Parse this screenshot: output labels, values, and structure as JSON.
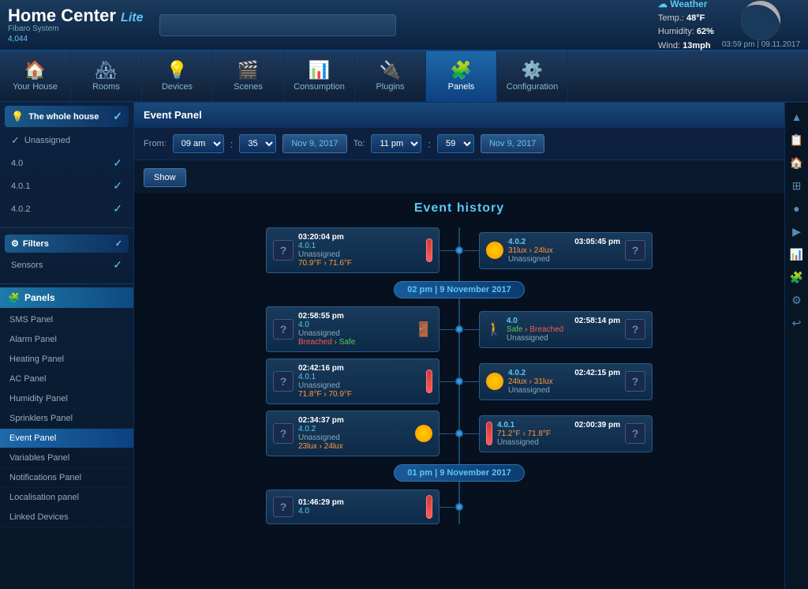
{
  "app": {
    "title": "Home Center",
    "subtitle": "Lite",
    "brand": "Fibaro System",
    "version": "4,044"
  },
  "weather": {
    "title": "Weather",
    "temp": "48°F",
    "humidity": "62%",
    "wind": "13mph",
    "datetime": "03:59 pm | 09.11.2017",
    "temp_label": "Temp.:",
    "humidity_label": "Humidity:",
    "wind_label": "Wind:"
  },
  "navbar": {
    "items": [
      {
        "id": "your-house",
        "label": "Your House",
        "icon": "🏠",
        "active": false
      },
      {
        "id": "rooms",
        "label": "Rooms",
        "icon": "🏘",
        "active": false
      },
      {
        "id": "devices",
        "label": "Devices",
        "icon": "💡",
        "active": false
      },
      {
        "id": "scenes",
        "label": "Scenes",
        "icon": "🎬",
        "active": false
      },
      {
        "id": "consumption",
        "label": "Consumption",
        "icon": "📊",
        "active": false
      },
      {
        "id": "plugins",
        "label": "Plugins",
        "icon": "🔌",
        "active": false
      },
      {
        "id": "panels",
        "label": "Panels",
        "icon": "🧩",
        "active": true
      },
      {
        "id": "configuration",
        "label": "Configuration",
        "icon": "⚙️",
        "active": false
      }
    ]
  },
  "sidebar": {
    "whole_house_label": "The whole house",
    "unassigned_label": "Unassigned",
    "items": [
      {
        "label": "4.0",
        "checked": true
      },
      {
        "label": "4.0.1",
        "checked": true
      },
      {
        "label": "4.0.2",
        "checked": true
      }
    ],
    "filters_label": "Filters",
    "sensors_label": "Sensors",
    "panels_label": "Panels",
    "panel_items": [
      {
        "label": "SMS Panel",
        "active": false
      },
      {
        "label": "Alarm Panel",
        "active": false
      },
      {
        "label": "Heating Panel",
        "active": false
      },
      {
        "label": "AC Panel",
        "active": false
      },
      {
        "label": "Humidity Panel",
        "active": false
      },
      {
        "label": "Sprinklers Panel",
        "active": false
      },
      {
        "label": "Event Panel",
        "active": true
      },
      {
        "label": "Variables Panel",
        "active": false
      },
      {
        "label": "Notifications Panel",
        "active": false
      },
      {
        "label": "Localisation panel",
        "active": false
      },
      {
        "label": "Linked Devices",
        "active": false
      }
    ]
  },
  "content": {
    "panel_title": "Event Panel",
    "filter": {
      "from_label": "From:",
      "to_label": "To:",
      "from_hour": "09 am",
      "from_min": "35",
      "from_date": "Nov 9, 2017",
      "to_hour": "11 pm",
      "to_min": "59",
      "to_date": "Nov 9, 2017",
      "show_label": "Show"
    },
    "event_history_title": "Event history",
    "date_markers": [
      {
        "label": "02 pm | 9 November 2017"
      },
      {
        "label": "01 pm | 9 November 2017"
      }
    ],
    "events_left": [
      {
        "time": "03:20:04 pm",
        "device": "Unassigned",
        "value": "70.9°F › 71.6°F",
        "icon_type": "therm"
      },
      {
        "time": "02:58:55 pm",
        "device": "Unassigned",
        "value": "Breached › Safe",
        "value_color": "safe",
        "icon_type": "door",
        "device_id": "4.0"
      },
      {
        "time": "02:42:16 pm",
        "device": "Unassigned",
        "value": "71.8°F › 70.9°F",
        "icon_type": "therm",
        "device_id": "4.0.1"
      },
      {
        "time": "02:34:37 pm",
        "device": "Unassigned",
        "value": "23lux › 24lux",
        "icon_type": "sun",
        "device_id": "4.0.2"
      }
    ],
    "events_right": [
      {
        "time": "03:05:45 pm",
        "device": "4.0.2",
        "value": "31lux › 24lux",
        "unassigned": "Unassigned",
        "icon_type": "sun"
      },
      {
        "time": "02:58:14 pm",
        "device": "4.0",
        "value": "Safe › Breached",
        "unassigned": "Unassigned",
        "icon_type": "walk"
      },
      {
        "time": "02:42:15 pm",
        "device": "4.0.2",
        "value": "24lux › 31lux",
        "unassigned": "Unassigned",
        "icon_type": "sun"
      },
      {
        "time": "02:00:39 pm",
        "device": "4.0.1",
        "value": "71.2°F › 71.8°F",
        "unassigned": "Unassigned",
        "icon_type": "therm"
      }
    ],
    "last_event": {
      "time": "01:46:29 pm",
      "device": "4.0",
      "icon_type": "therm"
    }
  },
  "right_sidebar": {
    "icons": [
      "▲",
      "📋",
      "🏠",
      "⊞",
      "●",
      "▶",
      "📊",
      "⚙",
      "↩"
    ]
  }
}
